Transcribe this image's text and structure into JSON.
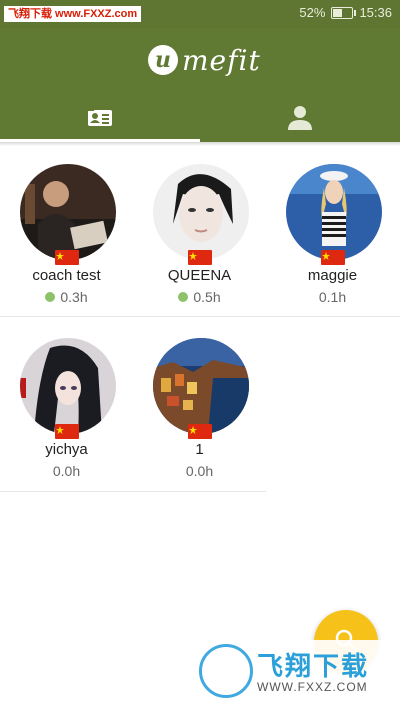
{
  "status_bar": {
    "watermark": "飞翔下载 www.FXXZ.com",
    "battery": "52%",
    "battery_level": 0.52,
    "time": "15:36"
  },
  "app": {
    "logo_letter": "u",
    "logo_text": "mefit"
  },
  "tabs": [
    {
      "icon": "contact-card-icon",
      "active": true
    },
    {
      "icon": "person-icon",
      "active": false
    }
  ],
  "users": [
    {
      "name": "coach test",
      "time": "0.3h",
      "online": true,
      "flag": "china-flag-icon"
    },
    {
      "name": "QUEENA",
      "time": "0.5h",
      "online": true,
      "flag": "china-flag-icon"
    },
    {
      "name": "maggie",
      "time": "0.1h",
      "online": false,
      "flag": "china-flag-icon"
    },
    {
      "name": "yichya",
      "time": "0.0h",
      "online": false,
      "flag": "china-flag-icon"
    },
    {
      "name": "1",
      "time": "0.0h",
      "online": false,
      "flag": "china-flag-icon"
    }
  ],
  "fab": {
    "icon": "search-icon",
    "color": "#f6c21a"
  },
  "watermark_bottom": {
    "cn": "飞翔下载",
    "url": "WWW.FXXZ.COM"
  },
  "colors": {
    "header": "#617a33",
    "online": "#8dc26a",
    "flag_red": "#de2910"
  }
}
